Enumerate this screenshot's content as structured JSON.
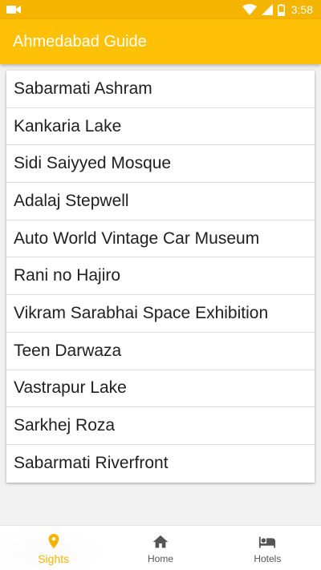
{
  "status_bar": {
    "time": "3:58",
    "icons": [
      "video-camera-icon",
      "wifi-icon",
      "signal-icon",
      "battery-icon"
    ]
  },
  "app_bar": {
    "title": "Ahmedabad Guide"
  },
  "sights": [
    "Sabarmati Ashram",
    "Kankaria Lake",
    "Sidi Saiyyed Mosque",
    "Adalaj Stepwell",
    "Auto World Vintage Car Museum",
    "Rani no Hajiro",
    "Vikram Sarabhai Space Exhibition",
    "Teen Darwaza",
    "Vastrapur Lake",
    "Sarkhej Roza",
    "Sabarmati Riverfront"
  ],
  "bottom_nav": {
    "items": [
      {
        "label": "Sights",
        "icon": "location-pin-icon",
        "active": true
      },
      {
        "label": "Home",
        "icon": "home-icon",
        "active": false
      },
      {
        "label": "Hotels",
        "icon": "bed-icon",
        "active": false
      }
    ]
  },
  "colors": {
    "status_bar": "#f5b400",
    "app_bar": "#fec106",
    "accent": "#f5b400",
    "background": "#f1f1f1"
  }
}
